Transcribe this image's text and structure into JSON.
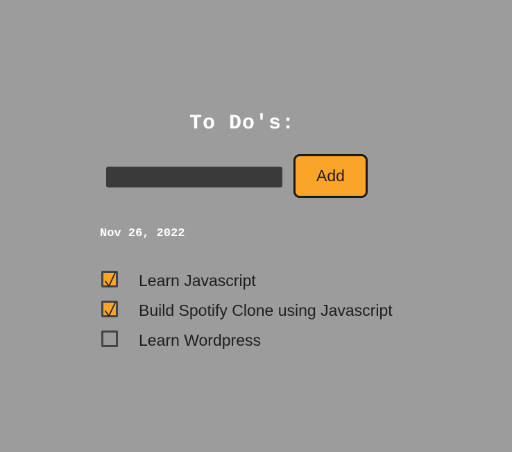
{
  "header": {
    "title": "To Do's:"
  },
  "form": {
    "input_value": "",
    "input_placeholder": "",
    "add_label": "Add"
  },
  "date": "Nov 26, 2022",
  "todos": [
    {
      "text": "Learn Javascript",
      "done": true
    },
    {
      "text": "Build Spotify Clone using Javascript",
      "done": true
    },
    {
      "text": "Learn Wordpress",
      "done": false
    }
  ],
  "colors": {
    "background": "#9c9c9c",
    "accent": "#f8a52a",
    "input_bg": "#3a3a3a",
    "text_dark": "#1e1e1e",
    "text_light": "#ffffff"
  },
  "icons": {
    "check": "check-icon"
  }
}
